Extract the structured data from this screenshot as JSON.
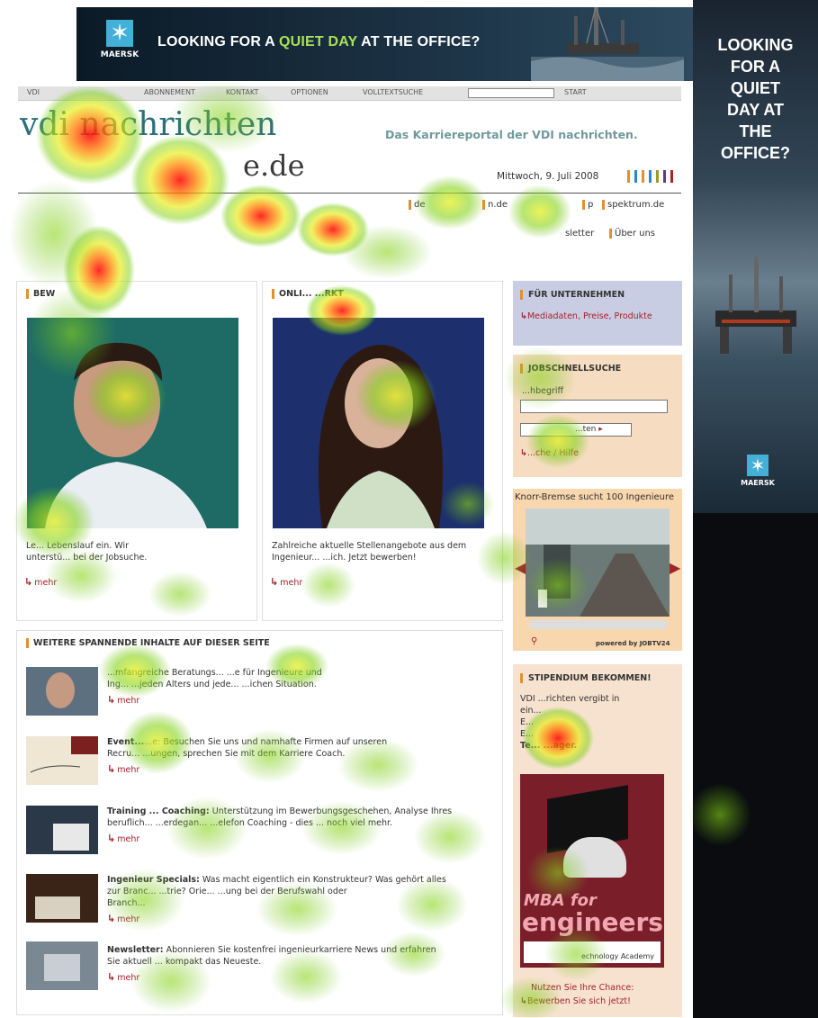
{
  "banner": {
    "logo_text": "MAERSK",
    "headline_pre": "LOOKING FOR A ",
    "headline_hl": "QUIET DAY",
    "headline_post": " AT THE OFFICE?"
  },
  "side_ad": {
    "lines": [
      "LOOKING",
      "FOR A",
      "QUIET",
      "DAY AT",
      "THE",
      "OFFICE?"
    ],
    "logo_text": "MAERSK"
  },
  "nav": {
    "items": [
      "VDI",
      "ABONNEMENT",
      "KONTAKT",
      "OPTIONEN",
      "VOLLTEXTSUCHE",
      "START"
    ]
  },
  "header": {
    "logo_main": "vdi nachrichten",
    "logo_domain": "e.de",
    "tagline": "Das Karriereportal der VDI nachrichten.",
    "date": "Mittwoch, 9. Juli 2008",
    "bar_colors": [
      "#e38f2c",
      "#2f86c6",
      "#e38f2c",
      "#2f86c6",
      "#9c9c2c",
      "#5c3c7c",
      "#b02020"
    ]
  },
  "subnav": {
    "items": [
      "de",
      "n.de",
      "p",
      "spektrum.de"
    ],
    "items2": [
      "sletter",
      "Über uns"
    ]
  },
  "box_bewerben": {
    "title": "BEW",
    "text_line1": "Le... Lebenslauf ein. Wir",
    "text_line2": "unterstü... bei der Jobsuche.",
    "mehr": "mehr"
  },
  "box_online": {
    "title": "ONLI... ...RKT",
    "text_line1": "Zahlreiche aktuelle Stellenangebote aus dem",
    "text_line2": "Ingenieur... ...ich. Jetzt bewerben!",
    "mehr": "mehr"
  },
  "weitere": {
    "title": "WEITERE SPANNENDE INHALTE AUF DIESER SEITE",
    "items": [
      {
        "bold": "",
        "text": "...mfangreiche Beratungs... ...e für Ingenieure und",
        "text2": "Ing... ...jeden Alters und jede... ...ichen Situation.",
        "mehr": "mehr"
      },
      {
        "bold": "Event...",
        "text": "...e: Besuchen Sie uns und namhafte Firmen auf unseren",
        "text2": "Recru... ...ungen, sprechen Sie mit dem Karriere Coach.",
        "mehr": "mehr"
      },
      {
        "bold": "Training ... Coaching:",
        "text": " Unterstützung im Bewerbungsgeschehen, Analyse Ihres",
        "text2": "beruflich... ...erdegan... ...elefon Coaching - dies ... noch viel mehr.",
        "mehr": "mehr"
      },
      {
        "bold": "Ingenieur Specials:",
        "text": " Was macht eigentlich ein Konstrukteur? Was gehört alles",
        "text2": "zur Branc... ...trie? Orie... ...ung bei der Berufswahl oder",
        "text3": "Branch...",
        "mehr": "mehr"
      },
      {
        "bold": "Newsletter:",
        "text": " Abonnieren Sie kostenfrei ingenieurkarriere News und erfahren",
        "text2": "Sie aktuell ... kompakt das Neueste.",
        "mehr": "mehr"
      }
    ]
  },
  "unternehmen": {
    "title": "FÜR UNTERNEHMEN",
    "link": "Mediadaten, Preise, Produkte"
  },
  "jobsuche": {
    "title": "JOBSCHNELLSUCHE",
    "label": "...hbegriff",
    "button": "...ten",
    "link": "...che / Hilfe"
  },
  "video": {
    "title": "Knorr-Bremse sucht 100 Ingenieure",
    "powered": "powered by JOBTV24"
  },
  "stipendium": {
    "title": "STIPENDIUM BEKOMMEN!",
    "lines": [
      "VDI ...richten vergibt in",
      "ein...",
      "E...",
      "E...",
      "Te... ...ager."
    ],
    "mba_line1": "MBA for",
    "mba_line2": "engineers",
    "academy": "echnology Academy",
    "cta1": "Nutzen Sie Ihre Chance:",
    "cta2": "Bewerben Sie sich jetzt!"
  }
}
